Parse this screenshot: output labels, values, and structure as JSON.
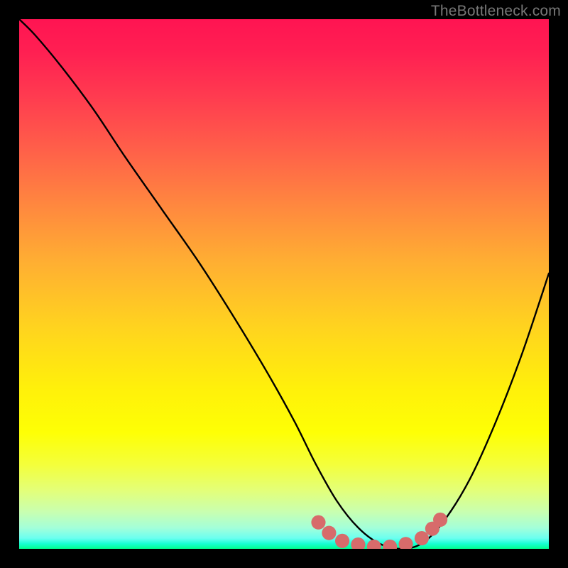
{
  "watermark": "TheBottleneck.com",
  "colors": {
    "curve_stroke": "#000000",
    "marker_fill": "#d76b6b",
    "marker_fill_alt": "#d76b6b"
  },
  "chart_data": {
    "type": "line",
    "title": "",
    "xlabel": "",
    "ylabel": "",
    "xlim": [
      0,
      100
    ],
    "ylim": [
      0,
      100
    ],
    "grid": false,
    "legend": false,
    "note": "No axis tick labels are visible in the source image; x and y units are arbitrary pixel-fraction percentages (0–100) read from the plot area.",
    "series": [
      {
        "name": "bottleneck-curve",
        "x": [
          0,
          3,
          8,
          14,
          20,
          27,
          34,
          41,
          47,
          52,
          56,
          60,
          64,
          68,
          72,
          76,
          80,
          85,
          90,
          95,
          100
        ],
        "y": [
          100,
          97,
          91,
          83,
          74,
          64,
          54,
          43,
          33,
          24,
          16,
          9,
          4,
          1,
          0,
          1,
          5,
          13,
          24,
          37,
          52
        ]
      }
    ],
    "markers": {
      "name": "optimal-zone-markers",
      "points": [
        {
          "x": 56.5,
          "y": 5.0
        },
        {
          "x": 58.5,
          "y": 3.0
        },
        {
          "x": 61.0,
          "y": 1.5
        },
        {
          "x": 64.0,
          "y": 0.8
        },
        {
          "x": 67.0,
          "y": 0.4
        },
        {
          "x": 70.0,
          "y": 0.4
        },
        {
          "x": 73.0,
          "y": 0.9
        },
        {
          "x": 76.0,
          "y": 2.0
        },
        {
          "x": 78.0,
          "y": 3.8
        },
        {
          "x": 79.5,
          "y": 5.5
        }
      ],
      "radius_pct": 1.35
    }
  }
}
